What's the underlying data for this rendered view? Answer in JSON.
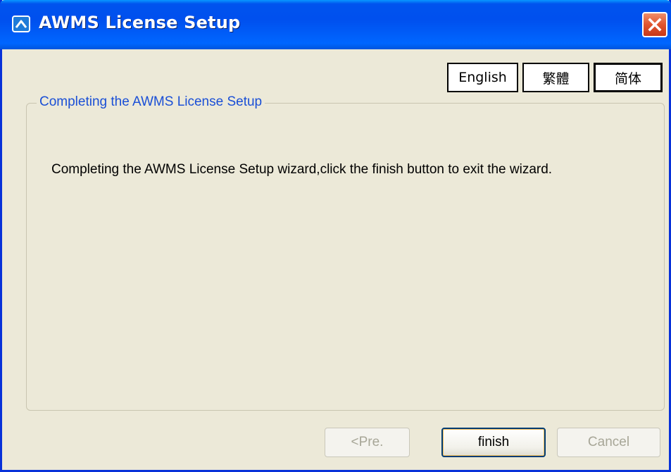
{
  "window": {
    "title": "AWMS License Setup"
  },
  "icons": {
    "app": "app-icon",
    "close": "close-icon"
  },
  "language_buttons": {
    "english": "English",
    "traditional_chinese": "繁體",
    "simplified_chinese": "简体",
    "selected": "简体"
  },
  "group": {
    "legend": "Completing the AWMS License Setup",
    "message": "Completing the AWMS License Setup wizard,click the finish button to exit the wizard."
  },
  "buttons": {
    "previous": "<Pre.",
    "finish": "finish",
    "cancel": "Cancel"
  },
  "colors": {
    "title_bar": "#0053ee",
    "close_button": "#e0542e",
    "window_background": "#ece9d8",
    "legend_text": "#1a4fd6",
    "disabled_text": "#a7a697"
  }
}
